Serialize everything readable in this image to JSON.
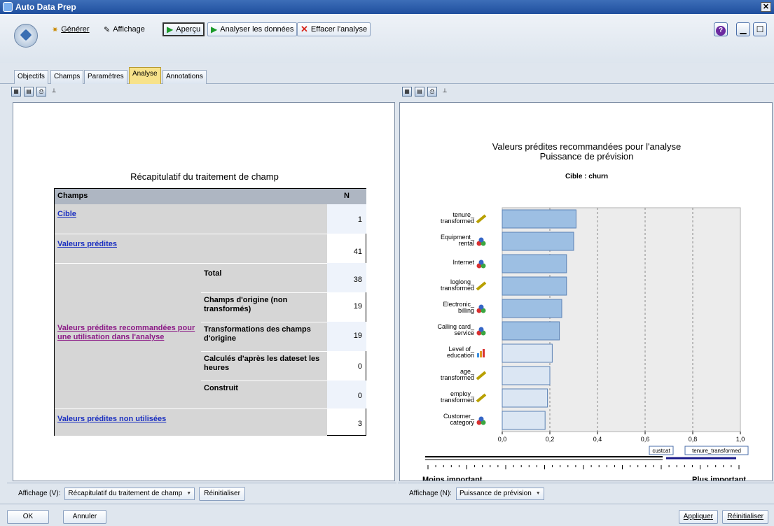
{
  "window": {
    "title": "Auto Data Prep",
    "close": "✕"
  },
  "toolbar": {
    "generate": "Générer",
    "display": "Affichage",
    "preview": "Aperçu",
    "analyze": "Analyser les données",
    "clear": "Effacer l'analyse",
    "help": "?"
  },
  "tabs": [
    "Objectifs",
    "Champs",
    "Paramètres",
    "Analyse",
    "Annotations"
  ],
  "left": {
    "table_title": "Récapitulatif du traitement de champ",
    "headers": {
      "fields": "Champs",
      "n": "N"
    },
    "rows": {
      "target": {
        "label": "Cible",
        "n": "1"
      },
      "predictors": {
        "label": "Valeurs prédites",
        "n": "41"
      },
      "recommended": {
        "label": "Valeurs prédites recommandées pour une utilisation dans l'analyse",
        "total": {
          "label": "Total",
          "n": "38"
        },
        "original": {
          "label": "Champs d'origine (non transformés)",
          "n": "19"
        },
        "transforms": {
          "label": "Transformations des champs d'origine",
          "n": "19"
        },
        "computed": {
          "label": "Calculés d'après les dateset les heures",
          "n": "0"
        },
        "constructed": {
          "label": "Construit",
          "n": "0"
        }
      },
      "unused": {
        "label": "Valeurs prédites non utilisées",
        "n": "3"
      }
    },
    "footer": {
      "label": "Affichage (V):",
      "select": "Récapitulatif du traitement de champ",
      "reset": "Réinitialiser"
    }
  },
  "right": {
    "title1": "Valeurs prédites recommandées pour l'analyse",
    "title2": "Puissance de prévision",
    "target": "Cible : churn",
    "footer": {
      "label": "Affichage (N):",
      "select": "Puissance de prévision"
    },
    "slider": {
      "left_label": "Moins important",
      "right_label": "Plus important",
      "left_thumb": "custcat",
      "right_thumb": "tenure_transformed"
    }
  },
  "chart_data": {
    "type": "bar",
    "orientation": "horizontal",
    "categories": [
      [
        "tenure_",
        "transformed"
      ],
      [
        "Equipment_",
        "rental"
      ],
      [
        "Internet"
      ],
      [
        "loglong_",
        "transformed"
      ],
      [
        "Electronic_",
        "billing"
      ],
      [
        "Calling card_",
        "service"
      ],
      [
        "Level of_",
        "education"
      ],
      [
        "age_",
        "transformed"
      ],
      [
        "employ_",
        "transformed"
      ],
      [
        "Customer_",
        "category"
      ]
    ],
    "icon_types": [
      "ruler",
      "set",
      "set",
      "ruler",
      "set",
      "set",
      "bars",
      "ruler",
      "ruler",
      "set"
    ],
    "values": [
      0.31,
      0.3,
      0.27,
      0.27,
      0.25,
      0.24,
      0.21,
      0.2,
      0.19,
      0.18
    ],
    "xlim": [
      0,
      1
    ],
    "xticks": [
      "0,0",
      "0,2",
      "0,4",
      "0,6",
      "0,8",
      "1,0"
    ],
    "bar_color": "#9dbfe3",
    "bar_color_light": "#dbe6f3"
  },
  "bottom": {
    "ok": "OK",
    "cancel": "Annuler",
    "apply": "Appliquer",
    "reset": "Réinitialiser"
  }
}
